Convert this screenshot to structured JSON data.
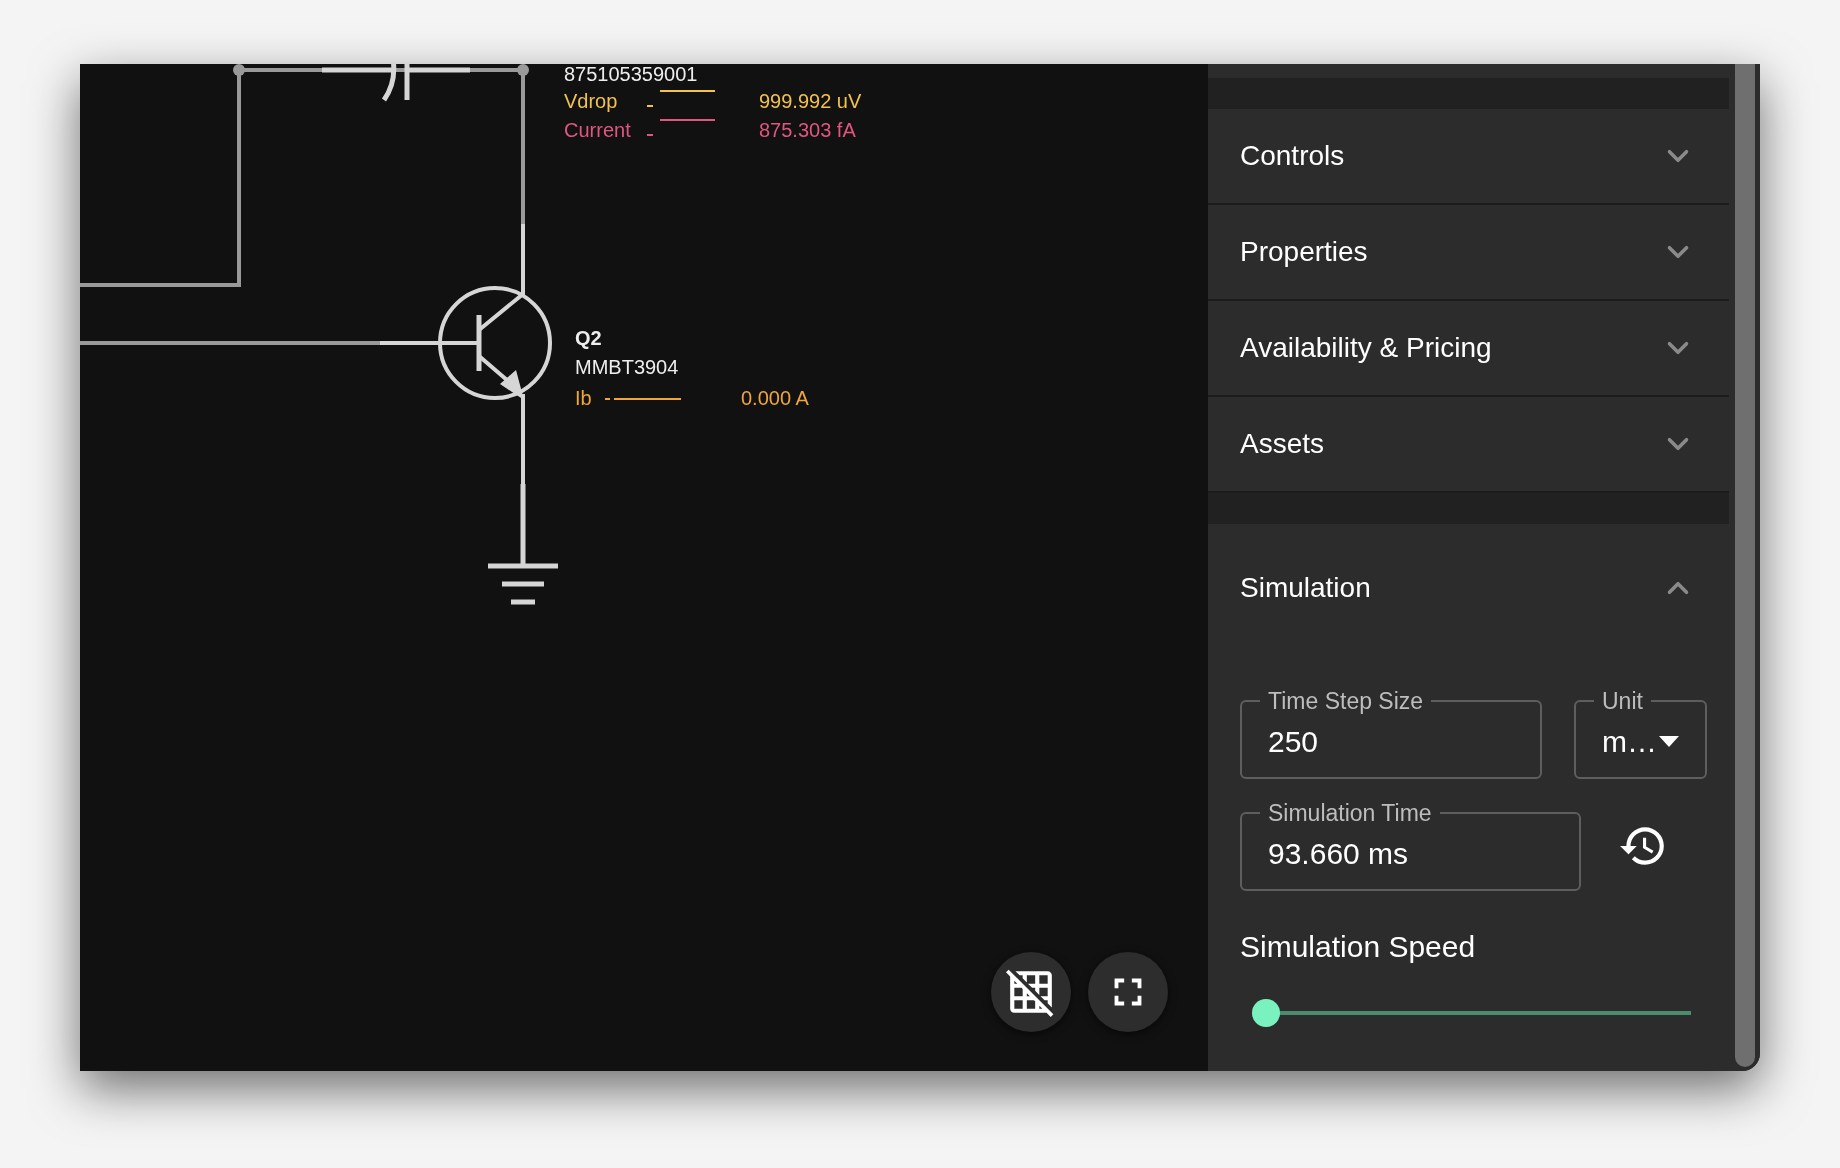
{
  "schematic": {
    "component_id": "875105359001",
    "probes": [
      {
        "label": "Vdrop",
        "value": "999.992 uV",
        "color": "#f2c14e"
      },
      {
        "label": "Current",
        "value": "875.303 fA",
        "color": "#e0567f"
      }
    ],
    "transistor": {
      "designator": "Q2",
      "part": "MMBT3904",
      "probes": [
        {
          "label": "Ib",
          "value": "0.000 A",
          "color": "#f0a53a"
        }
      ]
    }
  },
  "sections": [
    {
      "title": "Controls",
      "expanded": false
    },
    {
      "title": "Properties",
      "expanded": false
    },
    {
      "title": "Availability & Pricing",
      "expanded": false
    },
    {
      "title": "Assets",
      "expanded": false
    }
  ],
  "simulation": {
    "title": "Simulation",
    "expanded": true,
    "time_step": {
      "label": "Time Step Size",
      "value": "250"
    },
    "unit": {
      "label": "Unit",
      "value": "m…"
    },
    "simulation_time": {
      "label": "Simulation Time",
      "value": "93.660 ms"
    },
    "speed": {
      "label": "Simulation Speed",
      "level": 0
    }
  }
}
